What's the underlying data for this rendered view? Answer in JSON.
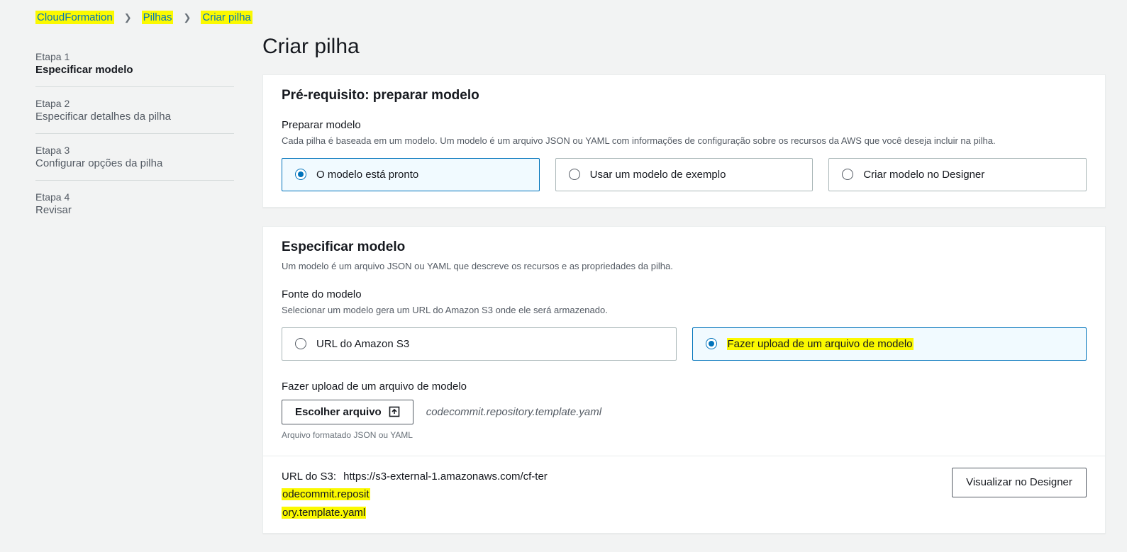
{
  "breadcrumb": {
    "items": [
      "CloudFormation",
      "Pilhas",
      "Criar pilha"
    ]
  },
  "steps": [
    {
      "num": "Etapa 1",
      "title": "Especificar modelo",
      "active": true
    },
    {
      "num": "Etapa 2",
      "title": "Especificar detalhes da pilha",
      "active": false
    },
    {
      "num": "Etapa 3",
      "title": "Configurar opções da pilha",
      "active": false
    },
    {
      "num": "Etapa 4",
      "title": "Revisar",
      "active": false
    }
  ],
  "page": {
    "title": "Criar pilha"
  },
  "panel_prereq": {
    "title": "Pré-requisito: preparar modelo",
    "section_label": "Preparar modelo",
    "section_desc": "Cada pilha é baseada em um modelo. Um modelo é um arquivo JSON ou YAML com informações de configuração sobre os recursos da AWS que você deseja incluir na pilha.",
    "options": [
      {
        "label": "O modelo está pronto",
        "selected": true
      },
      {
        "label": "Usar um modelo de exemplo",
        "selected": false
      },
      {
        "label": "Criar modelo no Designer",
        "selected": false
      }
    ]
  },
  "panel_specify": {
    "title": "Especificar modelo",
    "subtitle": "Um modelo é um arquivo JSON ou YAML que descreve os recursos e as propriedades da pilha.",
    "source_label": "Fonte do modelo",
    "source_desc": "Selecionar um modelo gera um URL do Amazon S3 onde ele será armazenado.",
    "options": [
      {
        "label": "URL do Amazon S3",
        "selected": false
      },
      {
        "label": "Fazer upload de um arquivo de modelo",
        "selected": true
      }
    ],
    "upload_label": "Fazer upload de um arquivo de modelo",
    "choose_file_button": "Escolher arquivo",
    "chosen_filename": "codecommit.repository.template.yaml",
    "file_hint": "Arquivo formatado JSON ou YAML",
    "s3_label": "URL do S3:",
    "s3_url_part1": "https://s3-external-1.amazonaws.com/cf-ter",
    "s3_url_hl1": "odecommit.reposit",
    "s3_url_hl2": "ory.template.yaml",
    "designer_button": "Visualizar no Designer"
  }
}
